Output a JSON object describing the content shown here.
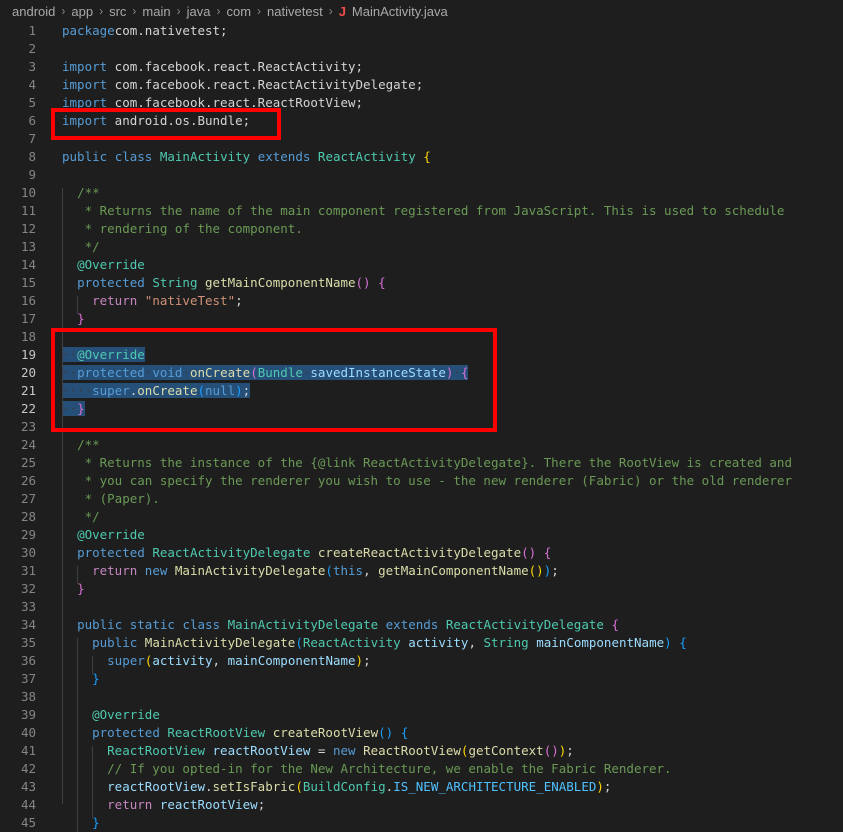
{
  "breadcrumb": {
    "items": [
      "android",
      "app",
      "src",
      "main",
      "java",
      "com",
      "nativetest"
    ],
    "file_icon": "J",
    "file": "MainActivity.java"
  },
  "lines": [
    {
      "n": "1",
      "t": [
        [
          "kw",
          "package"
        ],
        [
          "",
          "com.nativetest;"
        ]
      ]
    },
    {
      "n": "2",
      "t": []
    },
    {
      "n": "3",
      "t": [
        [
          "kw",
          "import"
        ],
        [
          "",
          " com.facebook.react.ReactActivity;"
        ]
      ]
    },
    {
      "n": "4",
      "t": [
        [
          "kw",
          "import"
        ],
        [
          "",
          " com.facebook.react.ReactActivityDelegate;"
        ]
      ]
    },
    {
      "n": "5",
      "t": [
        [
          "kw",
          "import"
        ],
        [
          "",
          " com.facebook.react.ReactRootView;"
        ]
      ]
    },
    {
      "n": "6",
      "t": [
        [
          "kw",
          "import"
        ],
        [
          "",
          " android.os.Bundle;"
        ]
      ]
    },
    {
      "n": "7",
      "t": []
    },
    {
      "n": "8",
      "t": [
        [
          "kw",
          "public"
        ],
        [
          "",
          " "
        ],
        [
          "kw",
          "class"
        ],
        [
          "",
          " "
        ],
        [
          "typ",
          "MainActivity"
        ],
        [
          "",
          " "
        ],
        [
          "kw",
          "extends"
        ],
        [
          "",
          " "
        ],
        [
          "typ",
          "ReactActivity"
        ],
        [
          "",
          " "
        ],
        [
          "br1",
          "{"
        ]
      ]
    },
    {
      "n": "9",
      "t": []
    },
    {
      "n": "10",
      "t": [
        [
          "",
          "  "
        ],
        [
          "cm",
          "/**"
        ]
      ]
    },
    {
      "n": "11",
      "t": [
        [
          "",
          "   "
        ],
        [
          "cm",
          "* Returns the name of the main component registered from JavaScript. This is used to schedule"
        ]
      ]
    },
    {
      "n": "12",
      "t": [
        [
          "",
          "   "
        ],
        [
          "cm",
          "* rendering of the component."
        ]
      ]
    },
    {
      "n": "13",
      "t": [
        [
          "",
          "   "
        ],
        [
          "cm",
          "*/"
        ]
      ]
    },
    {
      "n": "14",
      "t": [
        [
          "",
          "  "
        ],
        [
          "ann",
          "@Override"
        ]
      ]
    },
    {
      "n": "15",
      "t": [
        [
          "",
          "  "
        ],
        [
          "kw",
          "protected"
        ],
        [
          "",
          " "
        ],
        [
          "typ",
          "String"
        ],
        [
          "",
          " "
        ],
        [
          "fn",
          "getMainComponentName"
        ],
        [
          "br2",
          "()"
        ],
        [
          "",
          " "
        ],
        [
          "br2",
          "{"
        ]
      ]
    },
    {
      "n": "16",
      "t": [
        [
          "",
          "    "
        ],
        [
          "ctl",
          "return"
        ],
        [
          "",
          " "
        ],
        [
          "str",
          "\"nativeTest\""
        ],
        [
          ";"
        ]
      ]
    },
    {
      "n": "17",
      "t": [
        [
          "",
          "  "
        ],
        [
          "br2",
          "}"
        ]
      ]
    },
    {
      "n": "18",
      "t": []
    },
    {
      "n": "19",
      "sel": true,
      "t": [
        [
          "ws",
          "··"
        ],
        [
          "ann",
          "@Override"
        ]
      ]
    },
    {
      "n": "20",
      "sel": true,
      "t": [
        [
          "ws",
          "··"
        ],
        [
          "kw",
          "protected"
        ],
        [
          "ws",
          "·"
        ],
        [
          "kw",
          "void"
        ],
        [
          "ws",
          "·"
        ],
        [
          "fn",
          "onCreate"
        ],
        [
          "br2",
          "("
        ],
        [
          "typ",
          "Bundle"
        ],
        [
          "ws",
          "·"
        ],
        [
          "var",
          "savedInstanceState"
        ],
        [
          "br2",
          ")"
        ],
        [
          "ws",
          "·"
        ],
        [
          "br2",
          "{"
        ]
      ]
    },
    {
      "n": "21",
      "sel": true,
      "t": [
        [
          "ws",
          "····"
        ],
        [
          "kw",
          "super"
        ],
        [
          ".",
          ""
        ],
        [
          "fn",
          "onCreate"
        ],
        [
          "br3",
          "("
        ],
        [
          "kw",
          "null"
        ],
        [
          "br3",
          ")"
        ],
        [
          ";"
        ]
      ]
    },
    {
      "n": "22",
      "sel": true,
      "t": [
        [
          "ws",
          "··"
        ],
        [
          "br2",
          "}"
        ]
      ]
    },
    {
      "n": "23",
      "t": []
    },
    {
      "n": "24",
      "t": [
        [
          "",
          "  "
        ],
        [
          "cm",
          "/**"
        ]
      ]
    },
    {
      "n": "25",
      "t": [
        [
          "",
          "   "
        ],
        [
          "cm",
          "* Returns the instance of the {@link ReactActivityDelegate}. There the RootView is created and"
        ]
      ]
    },
    {
      "n": "26",
      "t": [
        [
          "",
          "   "
        ],
        [
          "cm",
          "* you can specify the renderer you wish to use - the new renderer (Fabric) or the old renderer"
        ]
      ]
    },
    {
      "n": "27",
      "t": [
        [
          "",
          "   "
        ],
        [
          "cm",
          "* (Paper)."
        ]
      ]
    },
    {
      "n": "28",
      "t": [
        [
          "",
          "   "
        ],
        [
          "cm",
          "*/"
        ]
      ]
    },
    {
      "n": "29",
      "t": [
        [
          "",
          "  "
        ],
        [
          "ann",
          "@Override"
        ]
      ]
    },
    {
      "n": "30",
      "t": [
        [
          "",
          "  "
        ],
        [
          "kw",
          "protected"
        ],
        [
          "",
          " "
        ],
        [
          "typ",
          "ReactActivityDelegate"
        ],
        [
          "",
          " "
        ],
        [
          "fn",
          "createReactActivityDelegate"
        ],
        [
          "br2",
          "()"
        ],
        [
          "",
          " "
        ],
        [
          "br2",
          "{"
        ]
      ]
    },
    {
      "n": "31",
      "t": [
        [
          "",
          "    "
        ],
        [
          "ctl",
          "return"
        ],
        [
          "",
          " "
        ],
        [
          "kw",
          "new"
        ],
        [
          "",
          " "
        ],
        [
          "fn",
          "MainActivityDelegate"
        ],
        [
          "br3",
          "("
        ],
        [
          "kw",
          "this"
        ],
        [
          ", "
        ],
        [
          "fn",
          "getMainComponentName"
        ],
        [
          "br1",
          "()"
        ],
        [
          "br3",
          ")"
        ],
        [
          ";"
        ]
      ]
    },
    {
      "n": "32",
      "t": [
        [
          "",
          "  "
        ],
        [
          "br2",
          "}"
        ]
      ]
    },
    {
      "n": "33",
      "t": []
    },
    {
      "n": "34",
      "t": [
        [
          "",
          "  "
        ],
        [
          "kw",
          "public"
        ],
        [
          "",
          " "
        ],
        [
          "kw",
          "static"
        ],
        [
          "",
          " "
        ],
        [
          "kw",
          "class"
        ],
        [
          "",
          " "
        ],
        [
          "typ",
          "MainActivityDelegate"
        ],
        [
          "",
          " "
        ],
        [
          "kw",
          "extends"
        ],
        [
          "",
          " "
        ],
        [
          "typ",
          "ReactActivityDelegate"
        ],
        [
          "",
          " "
        ],
        [
          "br2",
          "{"
        ]
      ]
    },
    {
      "n": "35",
      "t": [
        [
          "",
          "    "
        ],
        [
          "kw",
          "public"
        ],
        [
          "",
          " "
        ],
        [
          "fn",
          "MainActivityDelegate"
        ],
        [
          "br3",
          "("
        ],
        [
          "typ",
          "ReactActivity"
        ],
        [
          "",
          " "
        ],
        [
          "var",
          "activity"
        ],
        [
          ", "
        ],
        [
          "typ",
          "String"
        ],
        [
          "",
          " "
        ],
        [
          "var",
          "mainComponentName"
        ],
        [
          "br3",
          ")"
        ],
        [
          "",
          " "
        ],
        [
          "br3",
          "{"
        ]
      ]
    },
    {
      "n": "36",
      "t": [
        [
          "",
          "      "
        ],
        [
          "kw",
          "super"
        ],
        [
          "br1",
          "("
        ],
        [
          "var",
          "activity"
        ],
        [
          ", "
        ],
        [
          "var",
          "mainComponentName"
        ],
        [
          "br1",
          ")"
        ],
        [
          ";"
        ]
      ]
    },
    {
      "n": "37",
      "t": [
        [
          "",
          "    "
        ],
        [
          "br3",
          "}"
        ]
      ]
    },
    {
      "n": "38",
      "t": []
    },
    {
      "n": "39",
      "t": [
        [
          "",
          "    "
        ],
        [
          "ann",
          "@Override"
        ]
      ]
    },
    {
      "n": "40",
      "t": [
        [
          "",
          "    "
        ],
        [
          "kw",
          "protected"
        ],
        [
          "",
          " "
        ],
        [
          "typ",
          "ReactRootView"
        ],
        [
          "",
          " "
        ],
        [
          "fn",
          "createRootView"
        ],
        [
          "br3",
          "()"
        ],
        [
          "",
          " "
        ],
        [
          "br3",
          "{"
        ]
      ]
    },
    {
      "n": "41",
      "t": [
        [
          "",
          "      "
        ],
        [
          "typ",
          "ReactRootView"
        ],
        [
          "",
          " "
        ],
        [
          "var",
          "reactRootView"
        ],
        [
          "",
          " = "
        ],
        [
          "kw",
          "new"
        ],
        [
          "",
          " "
        ],
        [
          "fn",
          "ReactRootView"
        ],
        [
          "br1",
          "("
        ],
        [
          "fn",
          "getContext"
        ],
        [
          "br2",
          "()"
        ],
        [
          "br1",
          ")"
        ],
        [
          ";"
        ]
      ]
    },
    {
      "n": "42",
      "t": [
        [
          "",
          "      "
        ],
        [
          "cm",
          "// If you opted-in for the New Architecture, we enable the Fabric Renderer."
        ]
      ]
    },
    {
      "n": "43",
      "t": [
        [
          "",
          "      "
        ],
        [
          "var",
          "reactRootView"
        ],
        [
          "."
        ],
        [
          "fn",
          "setIsFabric"
        ],
        [
          "br1",
          "("
        ],
        [
          "typ",
          "BuildConfig"
        ],
        [
          "."
        ],
        [
          "cst",
          "IS_NEW_ARCHITECTURE_ENABLED"
        ],
        [
          "br1",
          ")"
        ],
        [
          ";"
        ]
      ]
    },
    {
      "n": "44",
      "t": [
        [
          "",
          "      "
        ],
        [
          "ctl",
          "return"
        ],
        [
          "",
          " "
        ],
        [
          "var",
          "reactRootView"
        ],
        [
          ";"
        ]
      ]
    },
    {
      "n": "45",
      "t": [
        [
          "",
          "    "
        ],
        [
          "br3",
          "}"
        ]
      ]
    }
  ],
  "highlight_boxes": [
    "import-bundle-box",
    "oncreate-box"
  ]
}
